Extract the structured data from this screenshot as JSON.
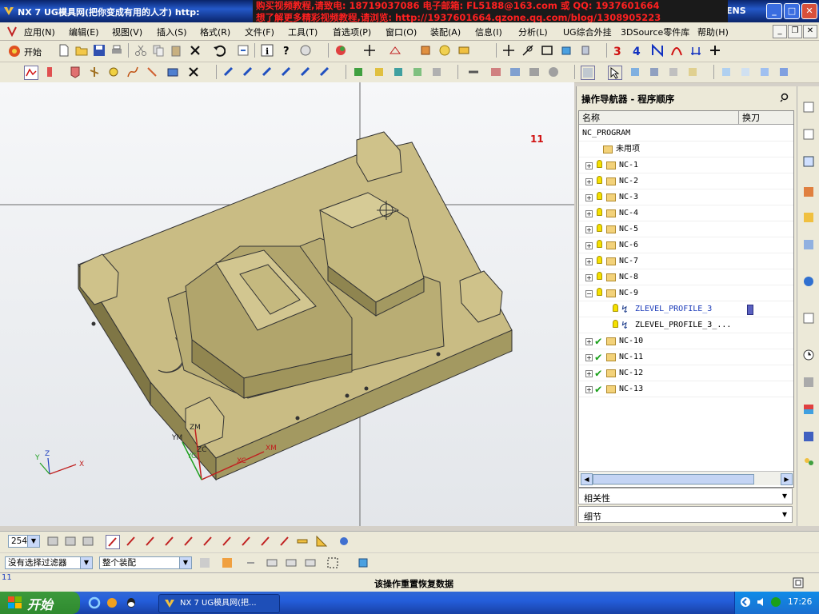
{
  "window": {
    "title": "NX 7 UG模具网(把你变成有用的人才) http:",
    "brand_suffix": "ENS",
    "min_label": "_",
    "max_label": "□",
    "close_label": "✕"
  },
  "banner": {
    "line1": "购买视频教程,请致电: 18719037086 电子邮箱: FL5188@163.com 或 QQ: 1937601664",
    "line2": "想了解更多精彩视频教程,请浏览: http://1937601664.qzone.qq.com/blog/1308905223"
  },
  "menubar": {
    "items": [
      "应用(N)",
      "编辑(E)",
      "视图(V)",
      "插入(S)",
      "格式(R)",
      "文件(F)",
      "工具(T)",
      "首选项(P)",
      "窗口(O)",
      "装配(A)",
      "信息(I)",
      "分析(L)",
      "UG综合外挂",
      "3DSource零件库",
      "帮助(H)"
    ]
  },
  "toolbar1": {
    "start_label": "开始"
  },
  "viewport": {
    "label_11": "11",
    "axis_labels": [
      "ZM",
      "YM",
      "YC",
      "ZC",
      "XM",
      "XC"
    ],
    "triad_labels": [
      "Y",
      "Z",
      "X"
    ]
  },
  "navigator": {
    "title": "操作导航器 - 程序顺序",
    "col_name": "名称",
    "col_tool_change": "换刀",
    "rows": [
      {
        "label": "NC_PROGRAM",
        "level": 0,
        "icon": "none"
      },
      {
        "label": "未用项",
        "level": 1,
        "icon": "folder"
      },
      {
        "label": "NC-1",
        "level": 1,
        "icon": "bulb",
        "exp": "+"
      },
      {
        "label": "NC-2",
        "level": 1,
        "icon": "bulb",
        "exp": "+"
      },
      {
        "label": "NC-3",
        "level": 1,
        "icon": "bulb",
        "exp": "+"
      },
      {
        "label": "NC-4",
        "level": 1,
        "icon": "bulb",
        "exp": "+"
      },
      {
        "label": "NC-5",
        "level": 1,
        "icon": "bulb",
        "exp": "+"
      },
      {
        "label": "NC-6",
        "level": 1,
        "icon": "bulb",
        "exp": "+"
      },
      {
        "label": "NC-7",
        "level": 1,
        "icon": "bulb",
        "exp": "+"
      },
      {
        "label": "NC-8",
        "level": 1,
        "icon": "bulb",
        "exp": "+"
      },
      {
        "label": "NC-9",
        "level": 1,
        "icon": "bulb",
        "exp": "-"
      },
      {
        "label": "ZLEVEL_PROFILE_3",
        "level": 2,
        "icon": "op",
        "selected": true
      },
      {
        "label": "ZLEVEL_PROFILE_3_...",
        "level": 2,
        "icon": "op"
      },
      {
        "label": "NC-10",
        "level": 1,
        "icon": "check",
        "exp": "+"
      },
      {
        "label": "NC-11",
        "level": 1,
        "icon": "check",
        "exp": "+"
      },
      {
        "label": "NC-12",
        "level": 1,
        "icon": "check",
        "exp": "+"
      },
      {
        "label": "NC-13",
        "level": 1,
        "icon": "check",
        "exp": "+"
      }
    ],
    "panel_dependencies": "相关性",
    "panel_details": "细节"
  },
  "bottombar": {
    "zoom_value": "254",
    "filter_value": "没有选择过滤器",
    "scope_value": "整个装配",
    "coord_label": "11"
  },
  "status": {
    "message": "该操作重置恢复数据"
  },
  "taskbar": {
    "start_label": "开始",
    "task_label": "NX 7 UG模具网(把...",
    "clock": "17:26"
  },
  "colors": {
    "part_body": "#c8bb82",
    "part_shadow": "#8e8452",
    "accent_blue": "#0a246a"
  }
}
